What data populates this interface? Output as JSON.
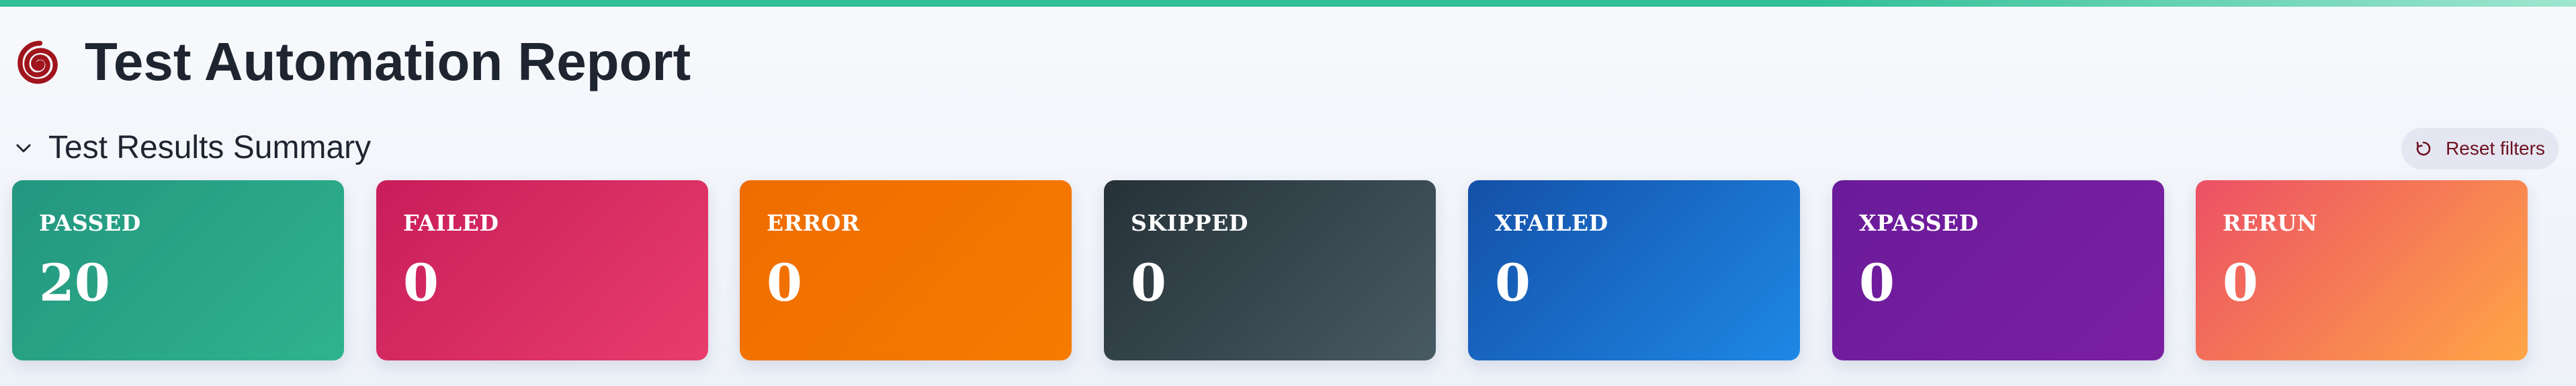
{
  "header": {
    "title": "Test Automation Report",
    "logo_icon": "spiral-logo-icon",
    "accent_bar_color": "#2fbf95"
  },
  "summary": {
    "toggle_icon": "chevron-down-icon",
    "title": "Test Results Summary",
    "reset_icon": "reset-refresh-icon",
    "reset_label": "Reset filters",
    "cards": [
      {
        "label": "PASSED",
        "count": "20",
        "color_start": "#23967f",
        "color_end": "#2fb38e"
      },
      {
        "label": "FAILED",
        "count": "0",
        "color_start": "#c81d5a",
        "color_end": "#e83d6b"
      },
      {
        "label": "ERROR",
        "count": "0",
        "color_start": "#ef6c00",
        "color_end": "#f57c00"
      },
      {
        "label": "SKIPPED",
        "count": "0",
        "color_start": "#263238",
        "color_end": "#485a63"
      },
      {
        "label": "XFAILED",
        "count": "0",
        "color_start": "#1450a8",
        "color_end": "#1e88e5"
      },
      {
        "label": "XPASSED",
        "count": "0",
        "color_start": "#6a1b9a",
        "color_end": "#7b1fa2"
      },
      {
        "label": "RERUN",
        "count": "0",
        "color_start": "#ec5065",
        "color_end": "#ffa646"
      }
    ]
  }
}
